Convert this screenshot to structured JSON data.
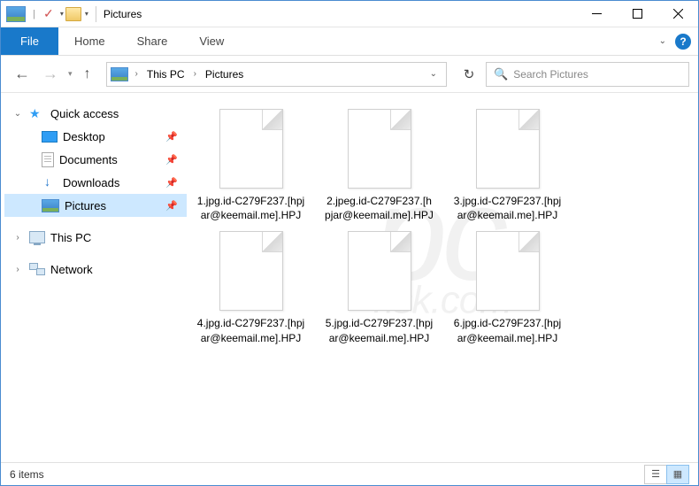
{
  "window": {
    "title": "Pictures"
  },
  "ribbon": {
    "file": "File",
    "tabs": [
      "Home",
      "Share",
      "View"
    ]
  },
  "breadcrumb": {
    "root_sep": "›",
    "parts": [
      "This PC",
      "Pictures"
    ]
  },
  "search": {
    "placeholder": "Search Pictures"
  },
  "sidebar": {
    "quick_access": "Quick access",
    "items": [
      {
        "label": "Desktop"
      },
      {
        "label": "Documents"
      },
      {
        "label": "Downloads"
      },
      {
        "label": "Pictures"
      }
    ],
    "this_pc": "This PC",
    "network": "Network"
  },
  "files": [
    "1.jpg.id-C279F237.[hpjar@keemail.me].HPJ",
    "2.jpeg.id-C279F237.[hpjar@keemail.me].HPJ",
    "3.jpg.id-C279F237.[hpjar@keemail.me].HPJ",
    "4.jpg.id-C279F237.[hpjar@keemail.me].HPJ",
    "5.jpg.id-C279F237.[hpjar@keemail.me].HPJ",
    "6.jpg.id-C279F237.[hpjar@keemail.me].HPJ"
  ],
  "status": {
    "count": "6 items"
  },
  "watermark": {
    "main": "pc",
    "sub": "risk.com"
  }
}
